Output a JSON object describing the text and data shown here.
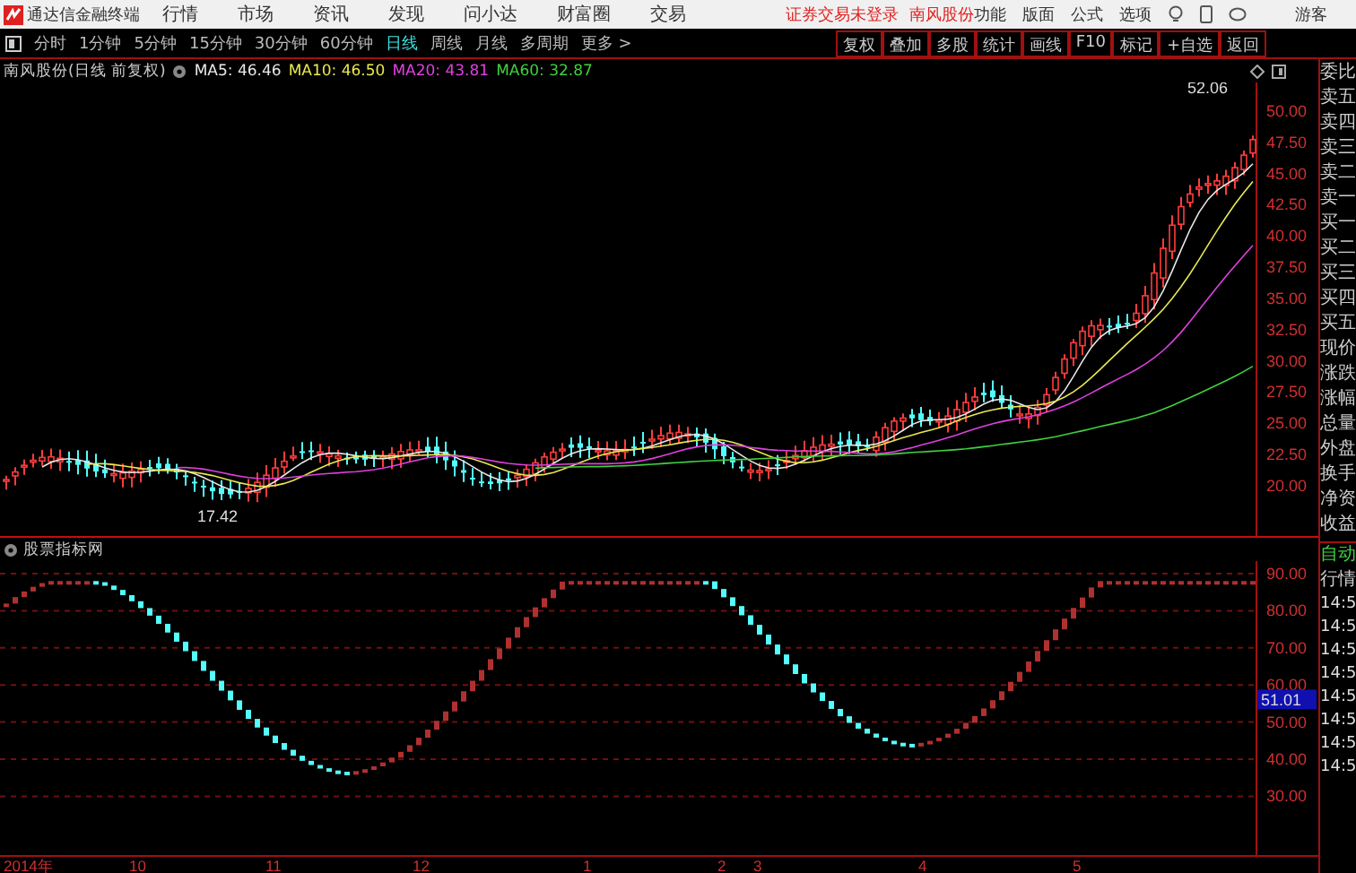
{
  "app": {
    "title": "通达信金融终端",
    "menu": [
      "行情",
      "市场",
      "资讯",
      "发现",
      "问小达",
      "财富圈",
      "交易"
    ],
    "login_status": "证券交易未登录",
    "stock_name": "南风股份",
    "system_menu": [
      "功能",
      "版面",
      "公式",
      "选项"
    ],
    "user": "游客"
  },
  "periods": [
    {
      "label": "分时",
      "selected": false
    },
    {
      "label": "1分钟",
      "selected": false
    },
    {
      "label": "5分钟",
      "selected": false
    },
    {
      "label": "15分钟",
      "selected": false
    },
    {
      "label": "30分钟",
      "selected": false
    },
    {
      "label": "60分钟",
      "selected": false
    },
    {
      "label": "日线",
      "selected": true
    },
    {
      "label": "周线",
      "selected": false
    },
    {
      "label": "月线",
      "selected": false
    },
    {
      "label": "多周期",
      "selected": false
    },
    {
      "label": "更多 >",
      "selected": false
    }
  ],
  "toolbar": [
    "复权",
    "叠加",
    "多股",
    "统计",
    "画线",
    "F10",
    "标记",
    "+自选",
    "返回"
  ],
  "chart_header": {
    "title": "南风股份(日线 前复权)",
    "ma": [
      {
        "label": "MA5: 46.46",
        "color": "#e8e8e8"
      },
      {
        "label": "MA10: 46.50",
        "color": "#e8e850"
      },
      {
        "label": "MA20: 43.81",
        "color": "#e040e0"
      },
      {
        "label": "MA60: 32.87",
        "color": "#40d040"
      }
    ]
  },
  "price_axis": [
    "50.00",
    "47.50",
    "45.00",
    "42.50",
    "40.00",
    "37.50",
    "35.00",
    "32.50",
    "30.00",
    "27.50",
    "25.00",
    "22.50",
    "20.00"
  ],
  "high_label": "52.06",
  "low_label": "17.42",
  "quote_labels": [
    "委比",
    "卖五",
    "卖四",
    "卖三",
    "卖二",
    "卖一",
    "买一",
    "买二",
    "买三",
    "买四",
    "买五",
    "现价",
    "涨跌",
    "涨幅",
    "总量",
    "外盘",
    "换手",
    "净资",
    "收益"
  ],
  "indicator": {
    "title": "股票指标网",
    "axis": [
      "90.00",
      "80.00",
      "70.00",
      "60.00",
      "50.00",
      "40.00",
      "30.00"
    ],
    "current_value": "51.01"
  },
  "side_lower": {
    "mode": "自动",
    "tab": "行情",
    "times": [
      "14:5",
      "14:5",
      "14:5",
      "14:5",
      "14:5",
      "14:5",
      "14:5",
      "14:5"
    ]
  },
  "date_axis": [
    "2014年",
    "10",
    "11",
    "12",
    "1",
    "2",
    "3",
    "4",
    "5"
  ]
}
